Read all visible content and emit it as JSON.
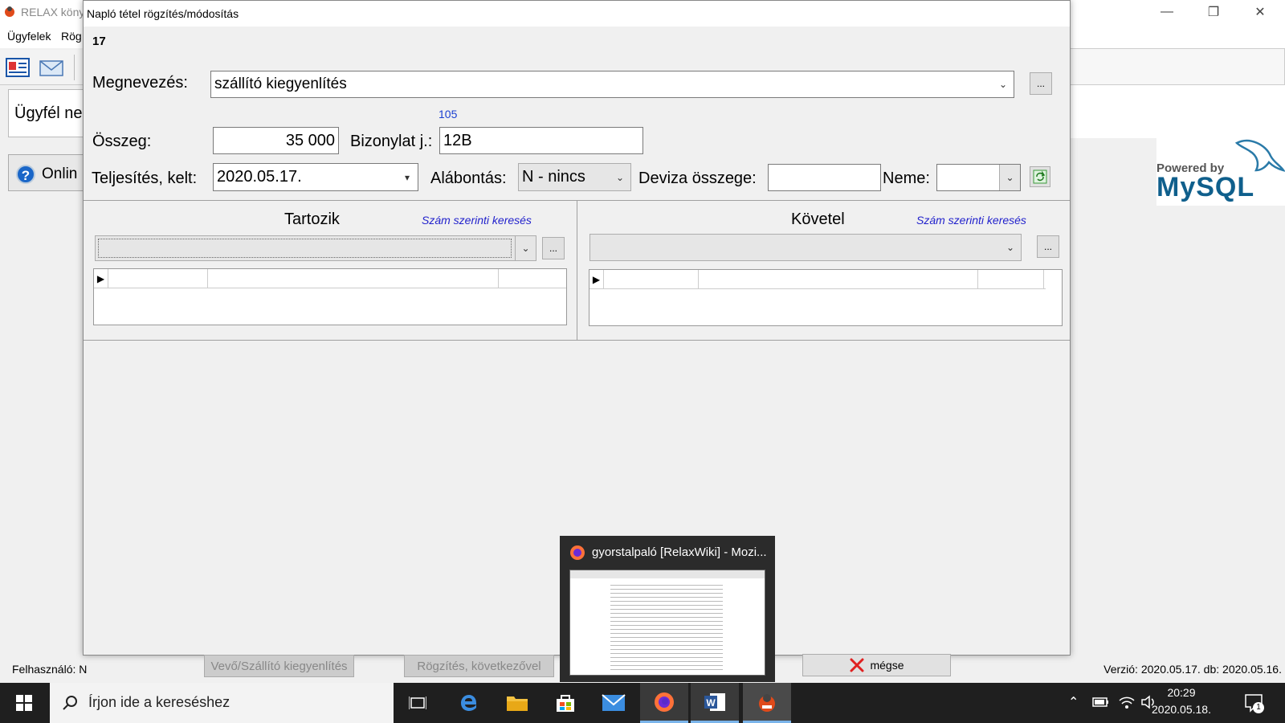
{
  "background_app": {
    "title": "RELAX köny",
    "menu": [
      "Ügyfelek",
      "Rög"
    ],
    "client_label": "Ügyfél ne",
    "online_label": "Onlin",
    "status_user": "Felhasználó: N",
    "status_version": "Verzió: 2020.05.17. db: 2020.05.16.",
    "mysql_logo_text_top": "Powered by",
    "mysql_logo_text_main": "MySQL"
  },
  "dialog": {
    "title": "Napló tétel rögzítés/módosítás",
    "record_id": "17",
    "labels": {
      "name": "Megnevezés:",
      "amount": "Összeg:",
      "voucher": "Bizonylat j.:",
      "date": "Teljesítés, kelt:",
      "breakdown": "Alábontás:",
      "currency_amount": "Deviza összege:",
      "currency_type": "Neme:"
    },
    "values": {
      "name": "szállító kiegyenlítés",
      "voucher_hint": "105",
      "amount": "35 000",
      "voucher": "12B",
      "date": "2020.05.17.",
      "breakdown": "N - nincs",
      "currency_amount": "",
      "currency_type": ""
    },
    "dots_label": "...",
    "debit": {
      "title": "Tartozik",
      "search_link": "Szám szerinti keresés"
    },
    "credit": {
      "title": "Követel",
      "search_link": "Szám szerinti keresés"
    },
    "buttons": {
      "supplier_settle": "Vevő/Szállító kiegyenlítés",
      "record_next": "Rögzítés, következővel",
      "cancel": "mégse"
    }
  },
  "taskbar": {
    "search_placeholder": "Írjon ide a kereséshez",
    "time": "20:29",
    "date": "2020.05.18.",
    "notification_count": "1"
  },
  "thumbnail": {
    "title": "gyorstalpaló [RelaxWiki] - Mozi..."
  },
  "colors": {
    "link_blue": "#2222cc",
    "hint_blue": "#1a3fd1",
    "cancel_red": "#e02020",
    "taskbar": "#1f1f1f"
  }
}
